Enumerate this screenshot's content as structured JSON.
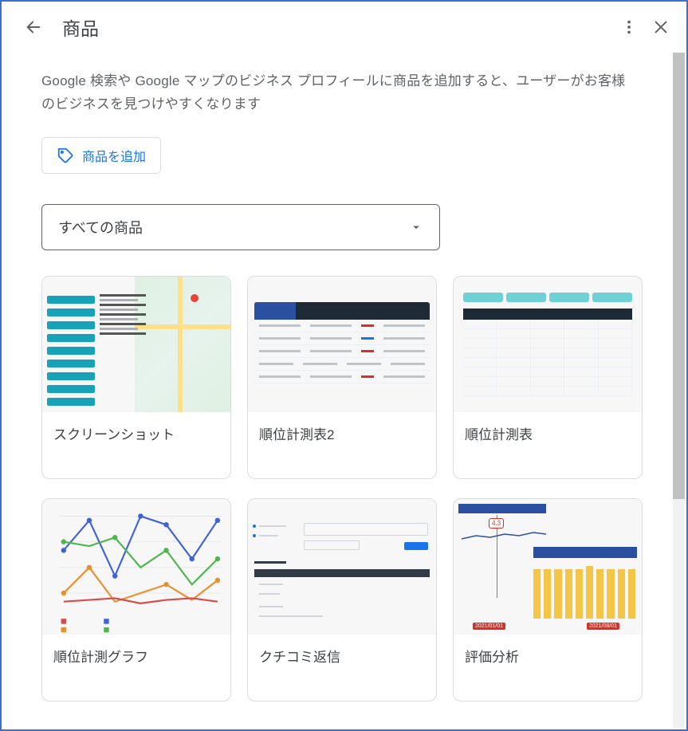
{
  "header": {
    "title": "商品"
  },
  "intro": "Google 検索や Google マップのビジネス プロフィールに商品を追加すると、ユーザーがお客様のビジネスを見つけやすくなります",
  "add_button_label": "商品を追加",
  "dropdown": {
    "selected": "すべての商品"
  },
  "products": [
    {
      "title": "スクリーンショット"
    },
    {
      "title": "順位計測表2"
    },
    {
      "title": "順位計測表"
    },
    {
      "title": "順位計測グラフ"
    },
    {
      "title": "クチコミ返信"
    },
    {
      "title": "評価分析"
    }
  ],
  "thumb6": {
    "badge": "4.3",
    "date1": "2021/01/01",
    "date2": "2021/08/01"
  }
}
